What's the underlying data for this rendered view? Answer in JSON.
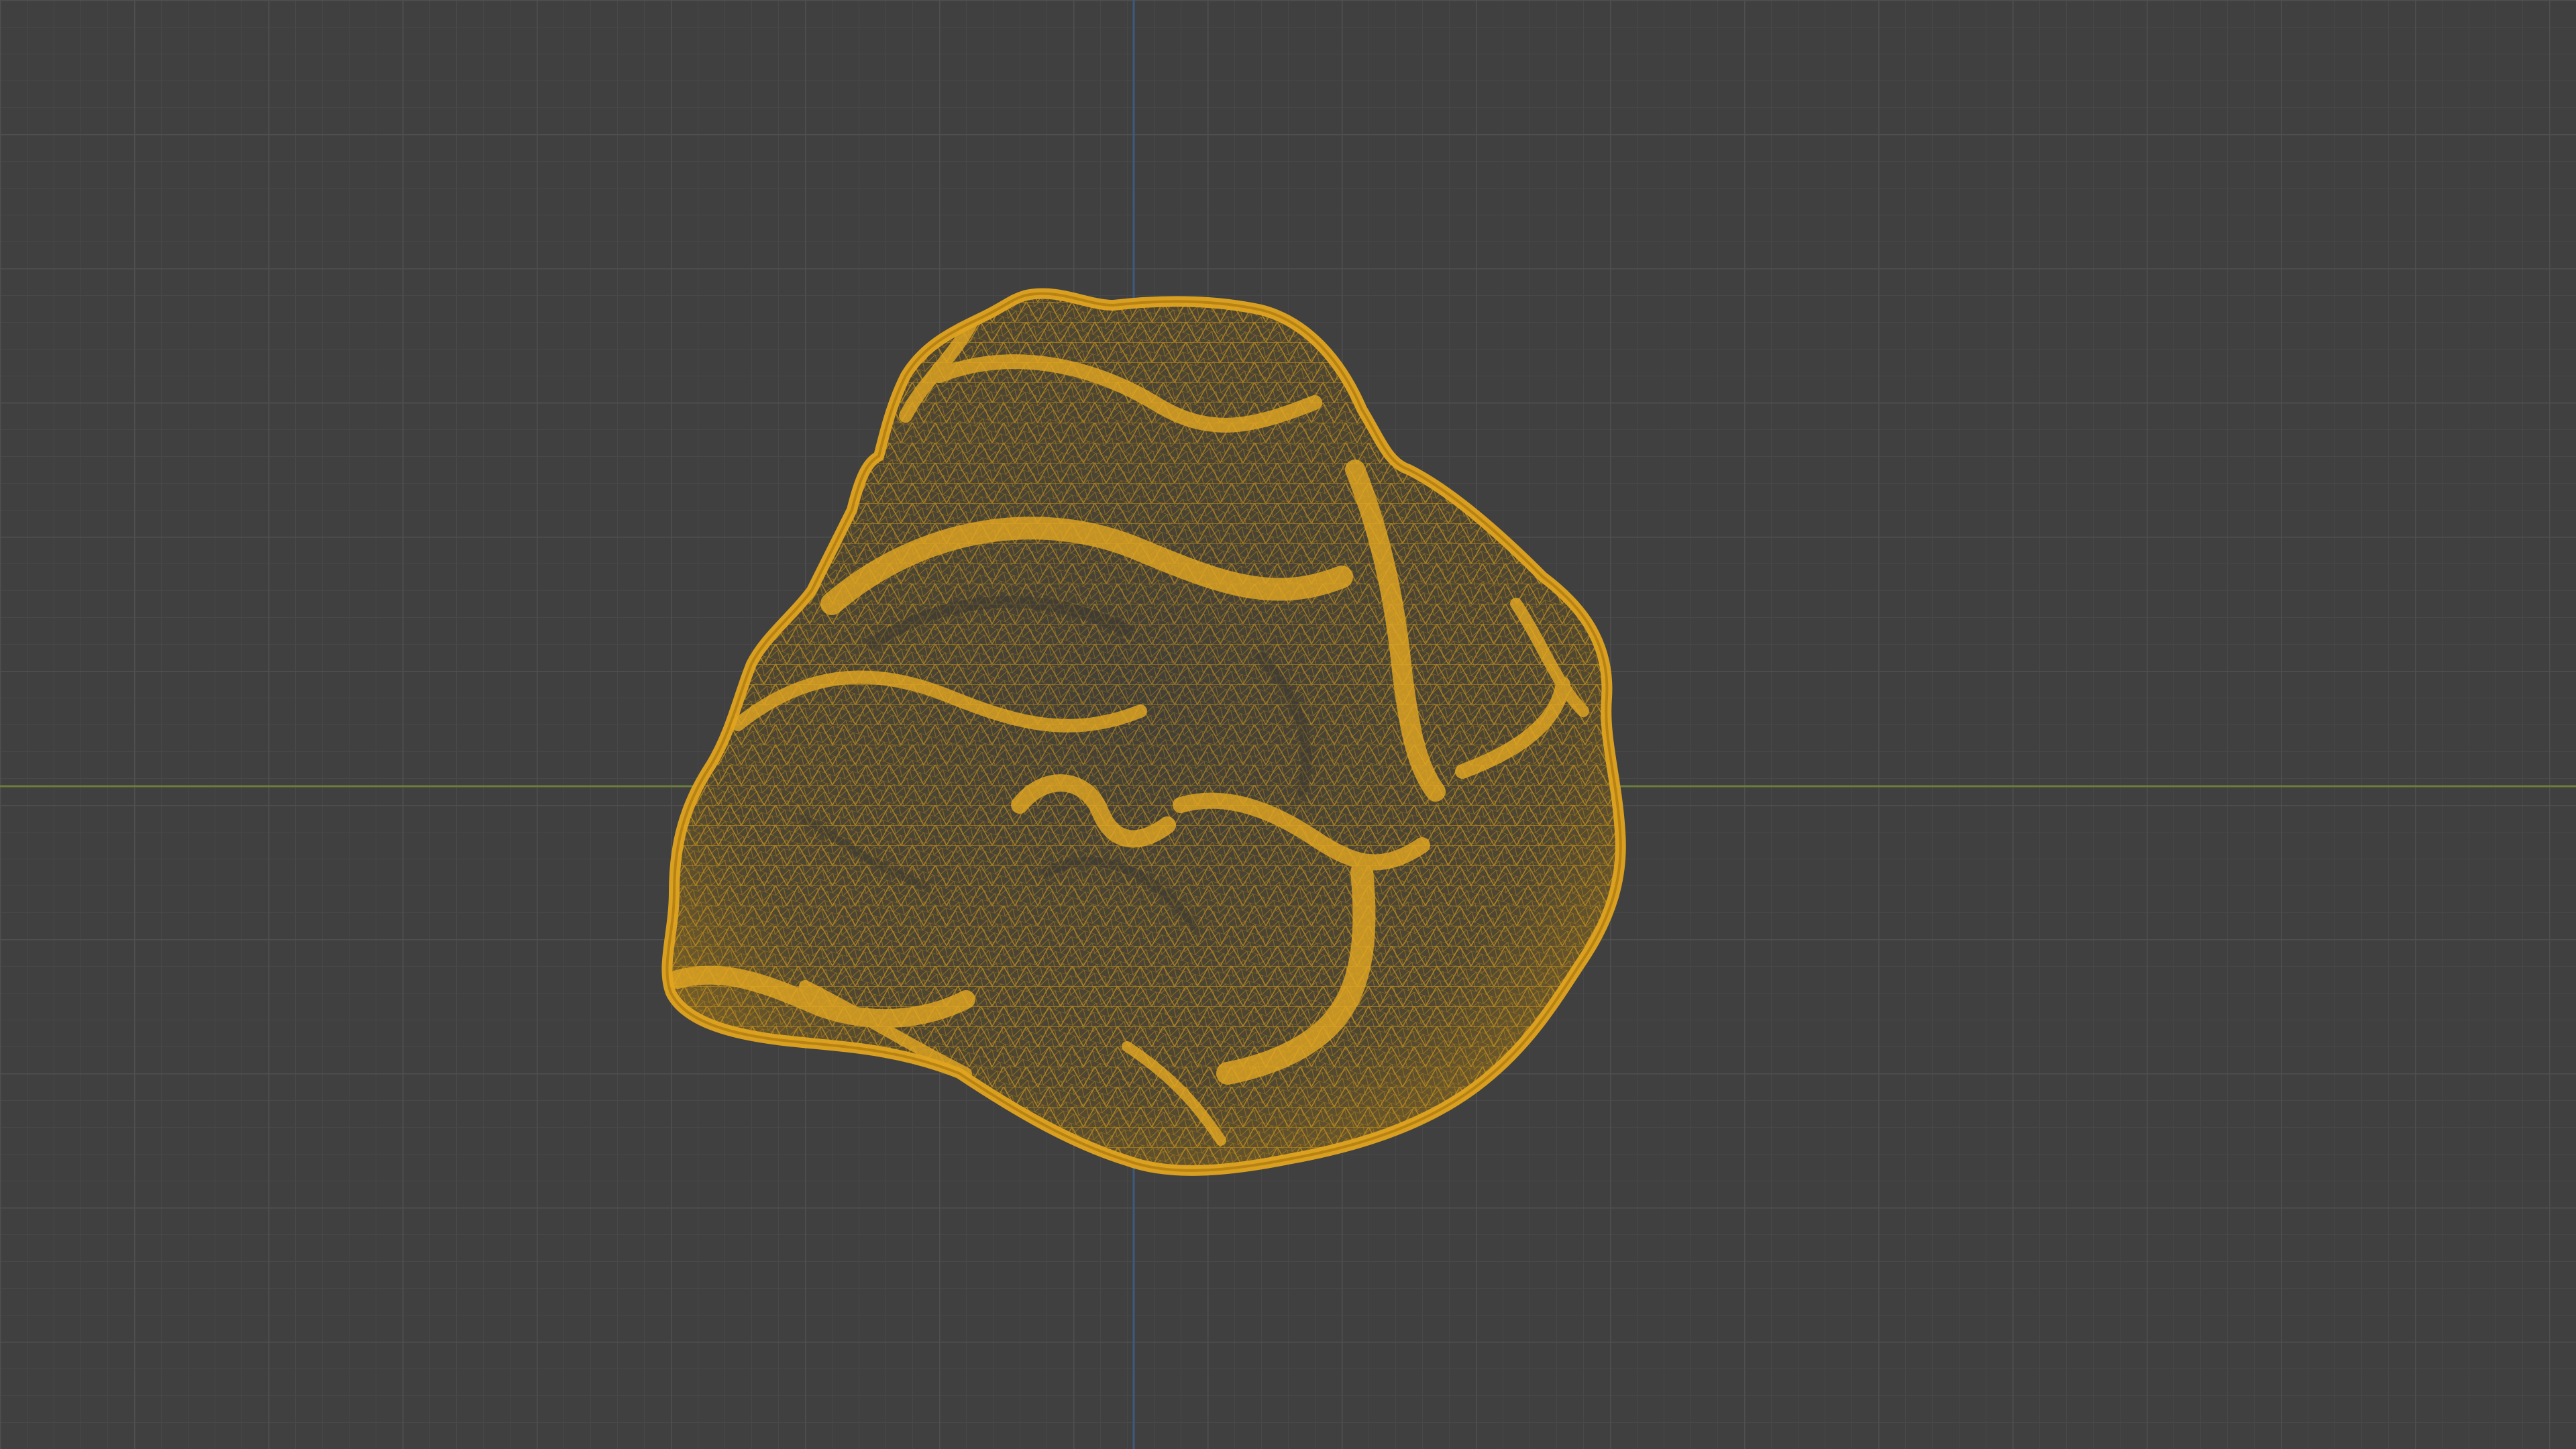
{
  "viewport": {
    "view_mode": "wireframe",
    "selected_object": "scanned-rock-mesh",
    "colors": {
      "background": "#404040",
      "grid_minor": "#484848",
      "grid_major": "#4f4f4f",
      "axis_x": "#6b7d3b",
      "axis_y": "#3d5a7a",
      "wire": "#e0a420",
      "wire_dark": "#b07c10",
      "wire_inner": "#cd9317"
    },
    "icons": {
      "grid": "viewport-grid",
      "axis_x": "x-axis-line",
      "axis_y": "y-axis-line",
      "mesh": "wireframe-mesh"
    }
  }
}
